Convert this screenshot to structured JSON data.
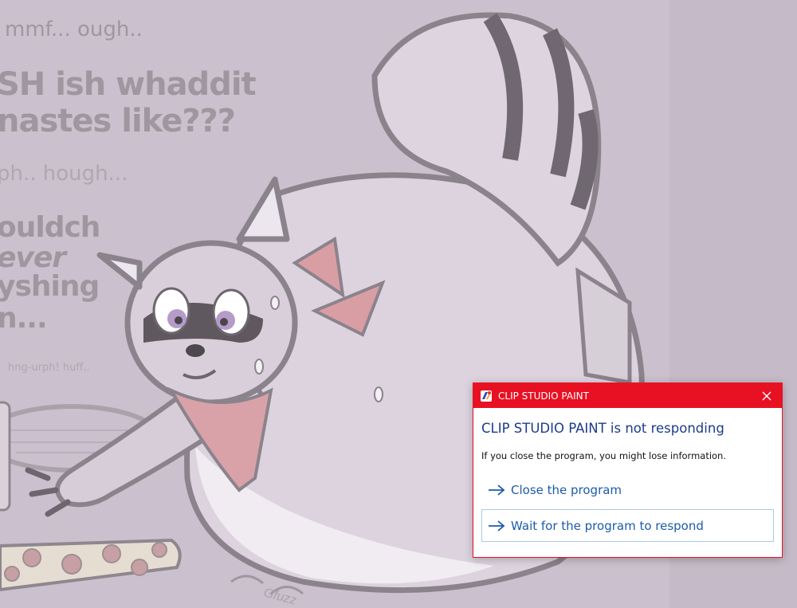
{
  "artwork": {
    "speech_lines": [
      "mmf... ough..",
      "SH ish whaddit",
      "nastes like???",
      "ph.. hough...",
      "ouldch",
      "ever",
      "yshing",
      "n...",
      "hng-urph! huff.."
    ],
    "signature": "Gfuzz"
  },
  "dialog": {
    "title": "CLIP STUDIO PAINT",
    "heading": "CLIP STUDIO PAINT is not responding",
    "info": "If you close the program, you might lose information.",
    "options": [
      {
        "label": "Close the program"
      },
      {
        "label": "Wait for the program to respond"
      }
    ],
    "titlebar_color": "#e81123",
    "heading_color": "#1c3b8b",
    "link_color": "#1c5ba8"
  }
}
